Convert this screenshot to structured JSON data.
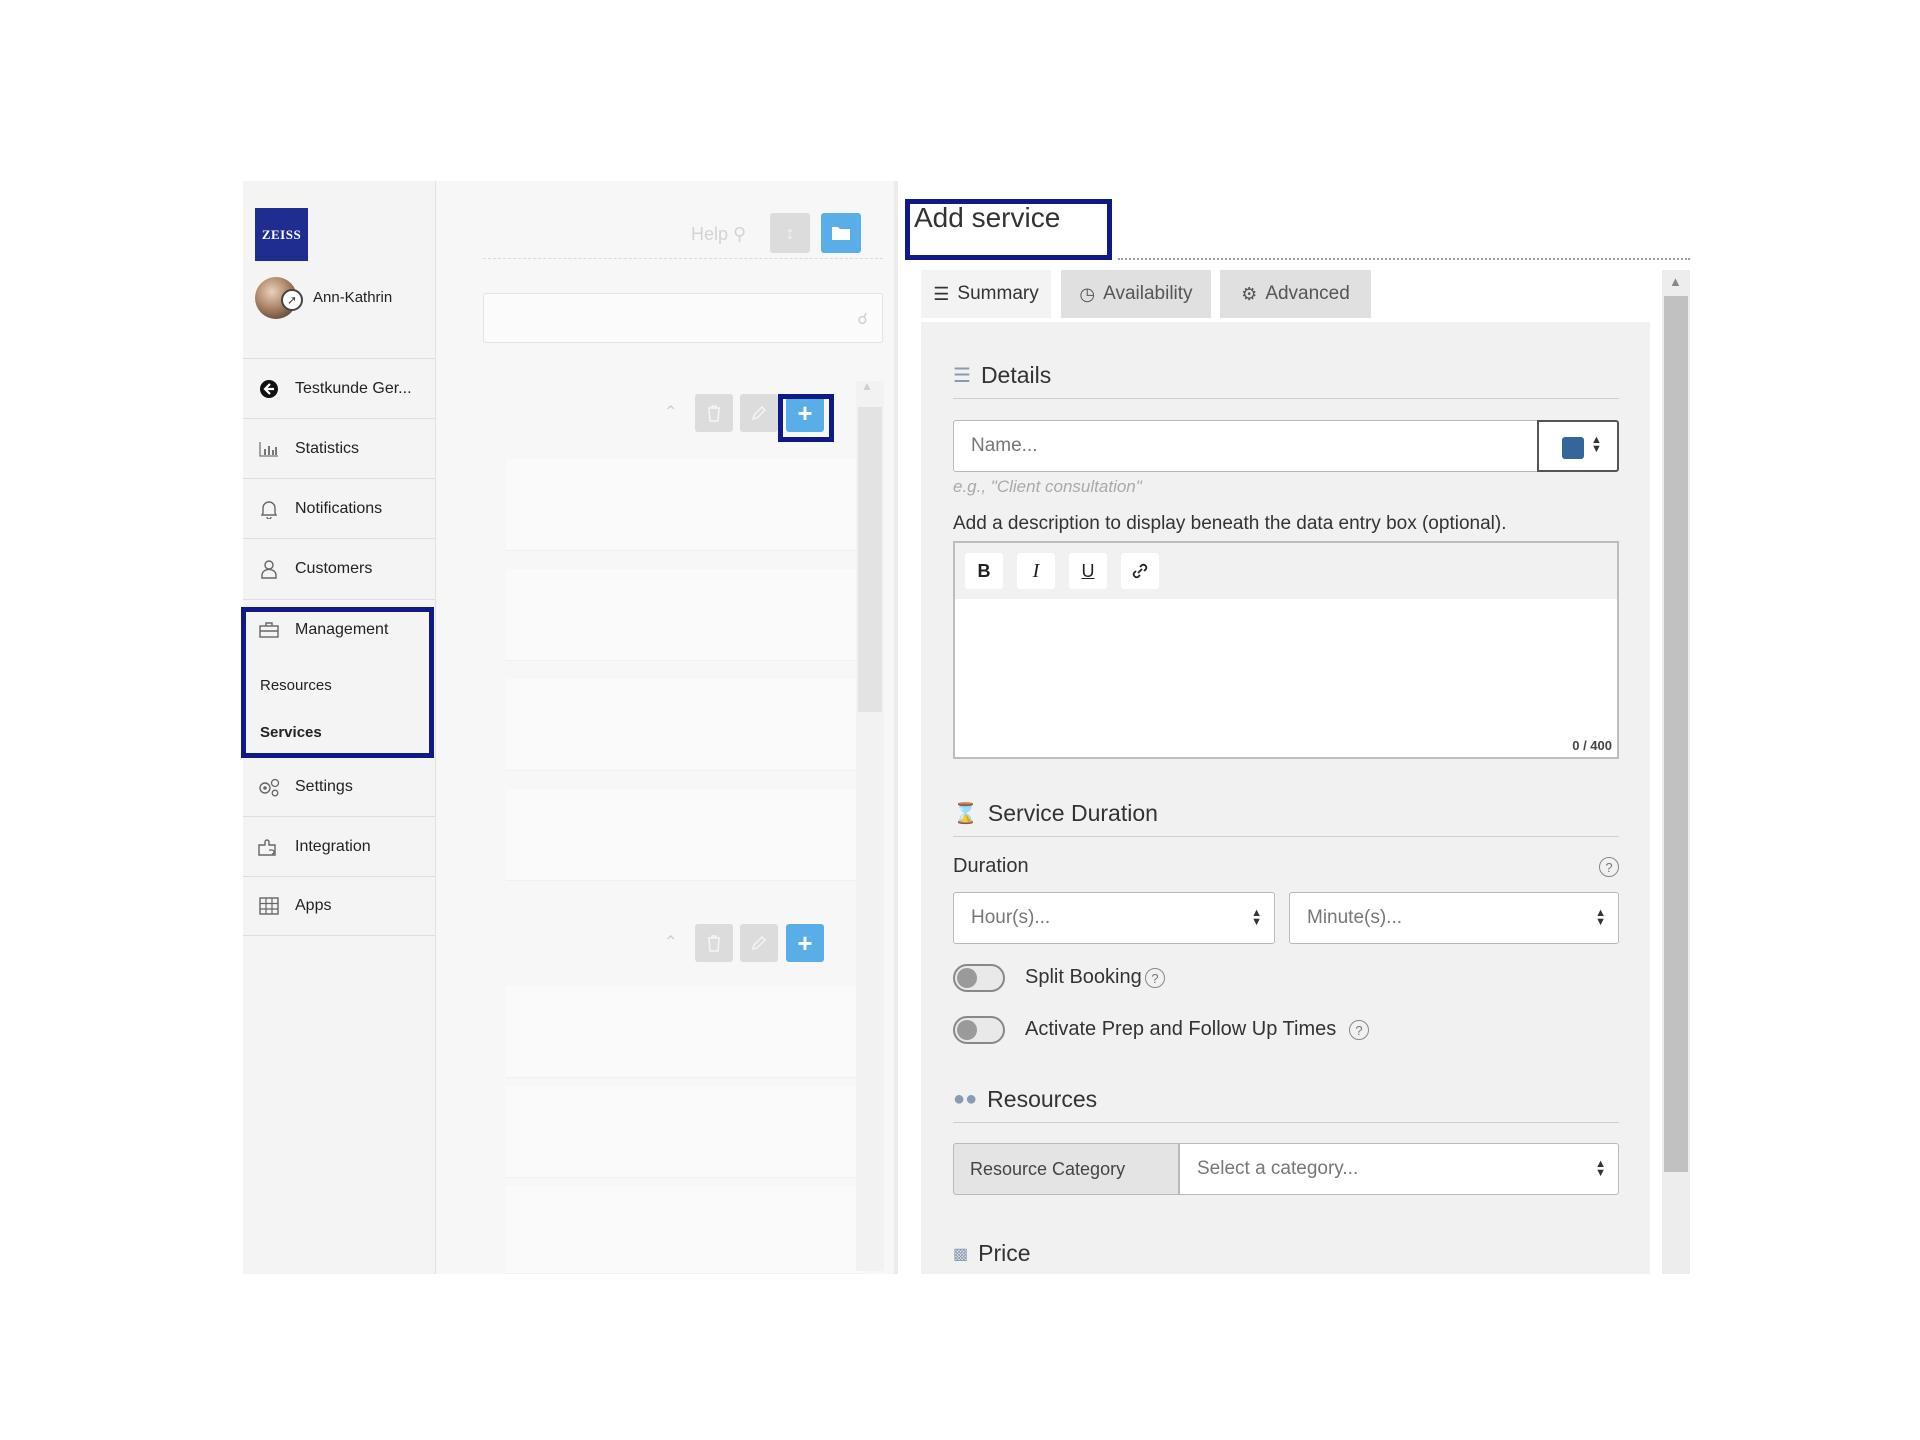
{
  "sidebar": {
    "logo_text": "ZEISS",
    "user": {
      "name": "Ann-Kathrin"
    },
    "items": [
      {
        "label": "Testkunde Ger...",
        "icon": "back-arrow-icon"
      },
      {
        "label": "Statistics",
        "icon": "bar-chart-icon"
      },
      {
        "label": "Notifications",
        "icon": "bell-icon"
      },
      {
        "label": "Customers",
        "icon": "user-icon"
      },
      {
        "label": "Management",
        "icon": "toolbox-icon"
      },
      {
        "label": "Settings",
        "icon": "gears-icon"
      },
      {
        "label": "Integration",
        "icon": "puzzle-icon"
      },
      {
        "label": "Apps",
        "icon": "grid-icon"
      }
    ],
    "management_subitems": [
      {
        "label": "Resources",
        "active": false
      },
      {
        "label": "Services",
        "active": true
      }
    ]
  },
  "middle": {
    "help_label": "Help"
  },
  "form": {
    "title": "Add service",
    "tabs": [
      {
        "label": "Summary",
        "icon": "list-icon",
        "active": true
      },
      {
        "label": "Availability",
        "icon": "clock-icon",
        "active": false
      },
      {
        "label": "Advanced",
        "icon": "gears-icon",
        "active": false
      }
    ],
    "details": {
      "title": "Details",
      "name_placeholder": "Name...",
      "name_hint": "e.g., \"Client consultation\"",
      "color_value": "#336699",
      "description_label": "Add a description to display beneath the data entry box (optional).",
      "editor_buttons": [
        "B",
        "I",
        "U"
      ],
      "counter": "0 / 400"
    },
    "duration": {
      "title": "Service Duration",
      "label": "Duration",
      "hours_placeholder": "Hour(s)...",
      "minutes_placeholder": "Minute(s)...",
      "split_booking_label": "Split Booking",
      "split_booking_on": false,
      "prep_label": "Activate Prep and Follow Up Times",
      "prep_on": false
    },
    "resources": {
      "title": "Resources",
      "category_label": "Resource Category",
      "category_placeholder": "Select a category..."
    },
    "price": {
      "title": "Price"
    }
  },
  "colors": {
    "highlight": "#0f1a86",
    "primary_blue": "#5aaee8",
    "logo_blue": "#1e2d8f"
  }
}
